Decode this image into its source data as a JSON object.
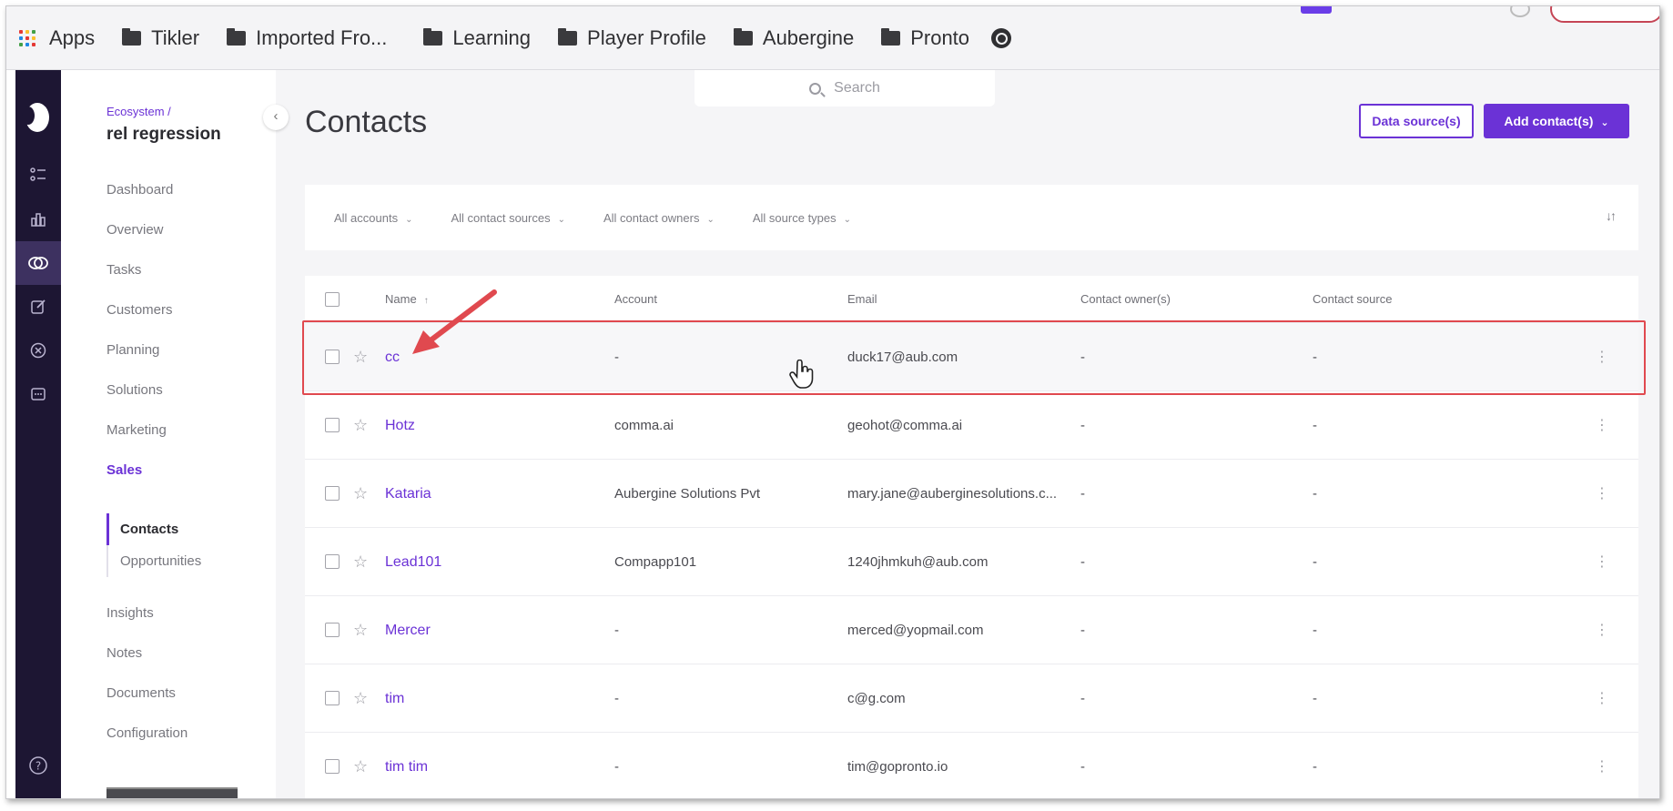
{
  "bookmarks": {
    "apps_label": "Apps",
    "items": [
      "Tikler",
      "Imported Fro...",
      "Learning",
      "Player Profile",
      "Aubergine",
      "Pronto"
    ]
  },
  "sidebar": {
    "breadcrumb": "Ecosystem /",
    "project": "rel regression",
    "nav": [
      "Dashboard",
      "Overview",
      "Tasks",
      "Customers",
      "Planning",
      "Solutions",
      "Marketing",
      "Sales",
      "Insights",
      "Notes",
      "Documents",
      "Configuration"
    ],
    "active_nav": "Sales",
    "subnav": [
      "Contacts",
      "Opportunities"
    ],
    "active_subnav": "Contacts"
  },
  "rail": {
    "icons": [
      "tasks-icon",
      "chart-icon",
      "ecosystem-icon",
      "edit-icon",
      "cancel-circle-icon",
      "chat-icon",
      "help-icon"
    ],
    "active": "ecosystem-icon"
  },
  "header": {
    "search_placeholder": "Search",
    "title": "Contacts",
    "data_source_button": "Data source(s)",
    "add_contact_button": "Add contact(s)"
  },
  "filters": [
    "All accounts",
    "All contact sources",
    "All contact owners",
    "All source types"
  ],
  "table": {
    "columns": [
      "Name",
      "Account",
      "Email",
      "Contact owner(s)",
      "Contact source"
    ],
    "rows": [
      {
        "name": "cc",
        "account": "-",
        "email": "duck17@aub.com",
        "owner": "-",
        "source": "-"
      },
      {
        "name": "Hotz",
        "account": "comma.ai",
        "email": "geohot@comma.ai",
        "owner": "-",
        "source": "-"
      },
      {
        "name": "Kataria",
        "account": "Aubergine Solutions Pvt",
        "email": "mary.jane@auberginesolutions.c...",
        "owner": "-",
        "source": "-"
      },
      {
        "name": "Lead101",
        "account": "Compapp101",
        "email": "1240jhmkuh@aub.com",
        "owner": "-",
        "source": "-"
      },
      {
        "name": "Mercer",
        "account": "-",
        "email": "merced@yopmail.com",
        "owner": "-",
        "source": "-"
      },
      {
        "name": "tim",
        "account": "-",
        "email": "c@g.com",
        "owner": "-",
        "source": "-"
      },
      {
        "name": "tim tim",
        "account": "-",
        "email": "tim@gopronto.io",
        "owner": "-",
        "source": "-"
      }
    ]
  },
  "colors": {
    "accent": "#6b32d6",
    "rail": "#1d1633",
    "annotation": "#e0494f"
  }
}
